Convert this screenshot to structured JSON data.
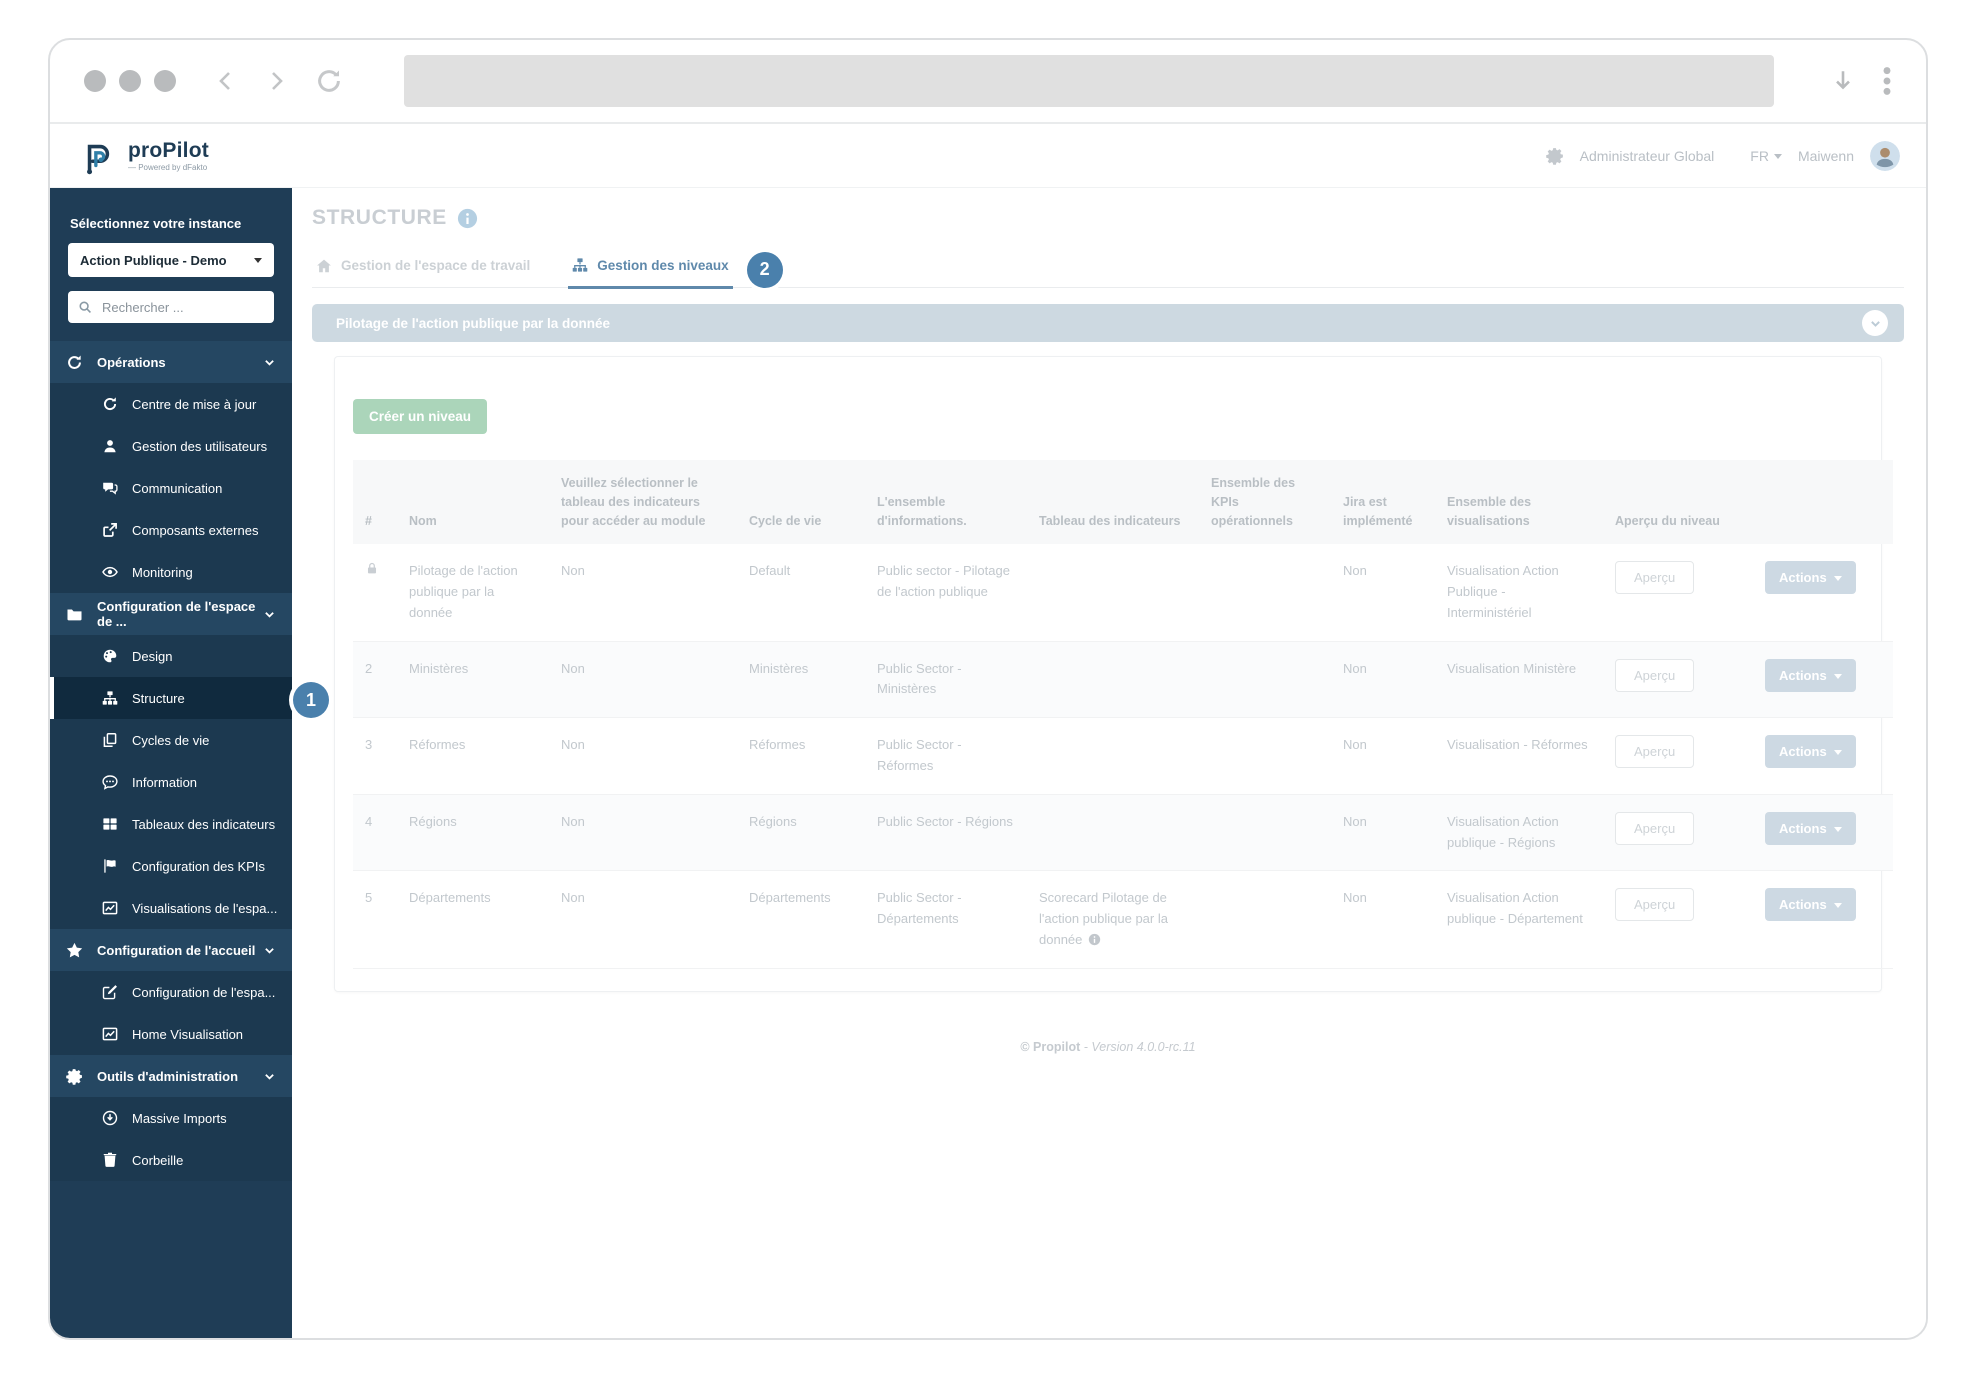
{
  "browser": {
    "url_value": ""
  },
  "header": {
    "logo_text": "proPilot",
    "logo_sub": "— Powered by dFakto",
    "role_label": "Administrateur Global",
    "lang_label": "FR",
    "user_name": "Maiwenn"
  },
  "sidebar": {
    "instance_label": "Sélectionnez votre instance",
    "instance_value": "Action Publique - Demo",
    "search_placeholder": "Rechercher ...",
    "sections": [
      {
        "label": "Opérations",
        "icon": "sync-icon",
        "items": [
          {
            "label": "Centre de mise à jour",
            "icon": "refresh-icon"
          },
          {
            "label": "Gestion des utilisateurs",
            "icon": "user-icon"
          },
          {
            "label": "Communication",
            "icon": "chat-icon"
          },
          {
            "label": "Composants externes",
            "icon": "external-icon"
          },
          {
            "label": "Monitoring",
            "icon": "eye-icon"
          }
        ]
      },
      {
        "label": "Configuration de l'espace de ...",
        "icon": "folder-icon",
        "items": [
          {
            "label": "Design",
            "icon": "palette-icon"
          },
          {
            "label": "Structure",
            "icon": "sitemap-icon",
            "active": true
          },
          {
            "label": "Cycles de vie",
            "icon": "copy-icon"
          },
          {
            "label": "Information",
            "icon": "comment-icon"
          },
          {
            "label": "Tableaux des indicateurs",
            "icon": "table-icon"
          },
          {
            "label": "Configuration des KPIs",
            "icon": "flag-icon"
          },
          {
            "label": "Visualisations de l'espa...",
            "icon": "chart-icon"
          }
        ]
      },
      {
        "label": "Configuration de l'accueil",
        "icon": "star-icon",
        "items": [
          {
            "label": "Configuration de l'espa...",
            "icon": "edit-icon"
          },
          {
            "label": "Home Visualisation",
            "icon": "chart-icon"
          }
        ]
      },
      {
        "label": "Outils d'administration",
        "icon": "gear-icon",
        "items": [
          {
            "label": "Massive Imports",
            "icon": "download-icon"
          },
          {
            "label": "Corbeille",
            "icon": "trash-icon"
          }
        ]
      }
    ]
  },
  "main": {
    "title": "STRUCTURE",
    "tabs": [
      {
        "label": "Gestion de l'espace de travail",
        "icon": "home-icon"
      },
      {
        "label": "Gestion des niveaux",
        "icon": "sitemap-icon",
        "active": true
      }
    ],
    "badge1": "1",
    "badge2": "2",
    "panel_title": "Pilotage de l'action publique par la donnée",
    "create_button": "Créer un niveau",
    "table": {
      "columns": [
        "#",
        "Nom",
        "Veuillez sélectionner le tableau des indicateurs pour accéder au module",
        "Cycle de vie",
        "L'ensemble d'informations.",
        "Tableau des indicateurs",
        "Ensemble des KPIs opérationnels",
        "Jira est implémenté",
        "Ensemble des visualisations",
        "Aperçu du niveau",
        ""
      ],
      "apercu_label": "Aperçu",
      "actions_label": "Actions",
      "rows": [
        {
          "num": "",
          "lock": true,
          "nom": "Pilotage de l'action publique par la donnée",
          "select": "Non",
          "cycle": "Default",
          "ensemble": "Public sector - Pilotage de l'action publique",
          "tableau": "",
          "kpis": "",
          "jira": "Non",
          "visualisations": "Visualisation Action Publique - Interministériel"
        },
        {
          "num": "2",
          "nom": "Ministères",
          "select": "Non",
          "cycle": "Ministères",
          "ensemble": "Public Sector - Ministères",
          "tableau": "",
          "kpis": "",
          "jira": "Non",
          "visualisations": "Visualisation Ministère"
        },
        {
          "num": "3",
          "nom": "Réformes",
          "select": "Non",
          "cycle": "Réformes",
          "ensemble": "Public Sector - Réformes",
          "tableau": "",
          "kpis": "",
          "jira": "Non",
          "visualisations": "Visualisation - Réformes"
        },
        {
          "num": "4",
          "nom": "Régions",
          "select": "Non",
          "cycle": "Régions",
          "ensemble": "Public Sector - Régions",
          "tableau": "",
          "kpis": "",
          "jira": "Non",
          "visualisations": "Visualisation Action publique - Régions"
        },
        {
          "num": "5",
          "nom": "Départements",
          "select": "Non",
          "cycle": "Départements",
          "ensemble": "Public Sector - Départements",
          "tableau": "Scorecard Pilotage de l'action publique par la donnée",
          "tableau_info": true,
          "kpis": "",
          "jira": "Non",
          "visualisations": "Visualisation Action publique - Département"
        }
      ]
    },
    "footer_copyright": "© Propilot",
    "footer_version": "- Version 4.0.0-rc.11"
  }
}
